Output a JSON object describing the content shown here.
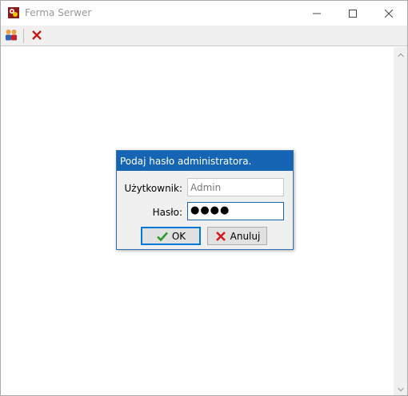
{
  "window": {
    "title": "Ferma Serwer",
    "controls": [
      "minimize",
      "maximize",
      "close"
    ]
  },
  "toolbar": {
    "items": [
      {
        "icon": "users-icon"
      },
      {
        "icon": "close-red-icon"
      }
    ]
  },
  "dialog": {
    "title": "Podaj hasło administratora.",
    "user_label": "Użytkownik:",
    "user_value": "Admin",
    "password_label": "Hasło:",
    "password_value": "●●●●",
    "ok_label": "OK",
    "cancel_label": "Anuluj"
  },
  "colors": {
    "dialog_title_bg": "#1565b4",
    "ok_check": "#2a9d2a",
    "cancel_x": "#d11a1a"
  }
}
